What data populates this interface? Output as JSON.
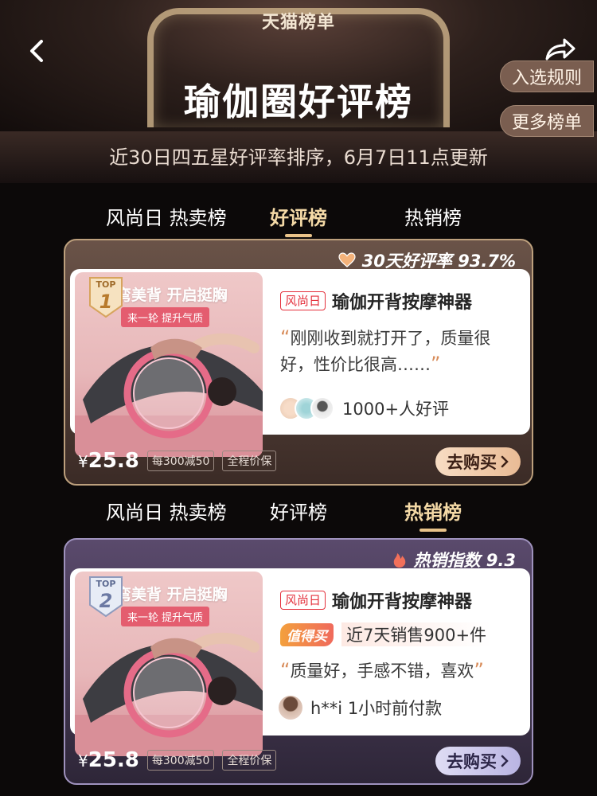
{
  "header": {
    "brand": "天猫榜单",
    "title": "瑜伽圈好评榜",
    "subtitle": "近30日四五星好评率排序，6月7日11点更新",
    "rule_label": "入选规则",
    "more_label": "更多榜单",
    "back_icon": "chevron-left-icon",
    "share_icon": "share-icon"
  },
  "tabs_top": [
    {
      "label": "风尚日 热卖榜"
    },
    {
      "label": "好评榜"
    },
    {
      "label": "热销榜"
    }
  ],
  "tabs_mid": [
    {
      "label": "风尚日 热卖榜"
    },
    {
      "label": "好评榜"
    },
    {
      "label": "热销榜"
    }
  ],
  "card1": {
    "rank_top": "TOP",
    "rank_num": "1",
    "metric": "30天好评率 93.7%",
    "metric_icon": "heart-icon",
    "image_line1": "弯美背 开启挺胸",
    "image_line2": "来一轮 提升气质",
    "shop_tag": "风尚日",
    "product_title": "瑜伽开背按摩神器",
    "review": "刚刚收到就打开了，质量很好，性价比很高……",
    "review_count": "1000+人好评",
    "price_symbol": "¥",
    "price": "25.8",
    "promo1": "每300减50",
    "promo2": "全程价保",
    "buy_label": "去购买"
  },
  "card2": {
    "rank_top": "TOP",
    "rank_num": "2",
    "metric": "热销指数 9.3",
    "metric_icon": "flame-icon",
    "image_line1": "弯美背 开启挺胸",
    "image_line2": "来一轮 提升气质",
    "shop_tag": "风尚日",
    "product_title": "瑜伽开背按摩神器",
    "worth_tag": "值得买",
    "sales": "近7天销售900+件",
    "review": "质量好，手感不错，喜欢",
    "buyer": "h**i 1小时前付款",
    "price_symbol": "¥",
    "price": "25.8",
    "promo1": "每300减50",
    "promo2": "全程价保",
    "buy_label": "去购买"
  },
  "colors": {
    "accent_gold": "#e9c389",
    "shop_red": "#e4303c",
    "card1_border": "#bda07d",
    "card2_border": "#9f92bd"
  }
}
